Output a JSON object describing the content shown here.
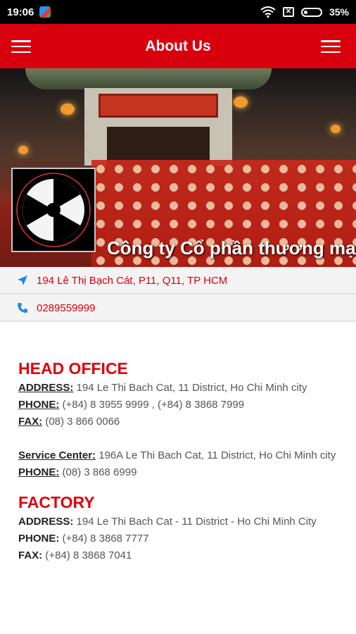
{
  "status_bar": {
    "time": "19:06",
    "battery": "35%",
    "battery_level": 0.35,
    "sim_glyph": "✕"
  },
  "app_bar": {
    "title": "About Us"
  },
  "hero": {
    "company_name": "Công ty Cổ phần thương mại"
  },
  "info": {
    "address": "194 Lê Thị Bạch Cát, P11, Q11, TP HCM",
    "phone": "0289559999"
  },
  "head_office": {
    "heading": "HEAD OFFICE",
    "address_label": "ADDRESS:",
    "address_value": "194 Le Thi Bach Cat, 11 District, Ho Chi Minh city",
    "phone_label": "PHONE:",
    "phone_value": "(+84) 8 3955 9999 , (+84) 8 3868 7999",
    "fax_label": "FAX:",
    "fax_value": "(08) 3 866 0066",
    "service_label": "Service Center:",
    "service_value": "196A Le Thi Bach Cat, 11 District, Ho Chi Minh city",
    "service_phone_label": "PHONE:",
    "service_phone_value": "(08) 3 868 6999"
  },
  "factory": {
    "heading": "FACTORY",
    "address_label": "ADDRESS:",
    "address_value": "194 Le Thi Bach Cat - 11 District - Ho Chi Minh City",
    "phone_label": "PHONE:",
    "phone_value": "(+84) 8 3868 7777",
    "fax_label": "FAX:",
    "fax_value": "(+84) 8 3868 7041"
  },
  "icons": {
    "menu_left": "hamburger-menu-icon",
    "menu_right": "hamburger-menu-icon",
    "location": "navigation-arrow-icon",
    "phone": "phone-icon",
    "wifi": "wifi-icon",
    "battery": "battery-icon"
  },
  "colors": {
    "brand_red": "#d9000e",
    "heading_red": "#e0000b",
    "icon_blue": "#1e88e5"
  }
}
